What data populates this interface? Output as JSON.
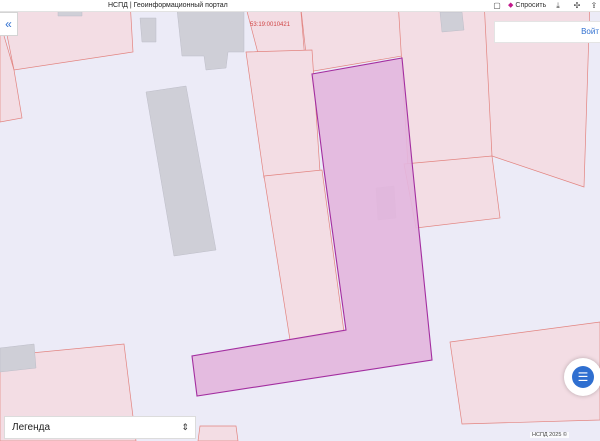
{
  "browser": {
    "tab_title": "НСПД | Геоинформационный портал",
    "ask_label": "Спросить"
  },
  "map": {
    "parcel_code": "53:19:0010421",
    "login_label": "Войт",
    "legend_label": "Легенда",
    "copyright": "НСПД 2025 ©",
    "colors": {
      "background": "#ecebf7",
      "parcel_fill": "#f3dde4",
      "parcel_border": "#e2837f",
      "building_fill": "#cfcfd7",
      "selected_fill": "#e3b6dd",
      "selected_border": "#a32ea0",
      "accent": "#2f6fd0"
    }
  },
  "icons": {
    "collapse": "double-chevron-left-icon",
    "chat": "chat-icon",
    "legend_toggle": "chevron-updown-icon",
    "bookmark": "bookmark-icon",
    "download": "download-icon",
    "extensions": "extensions-icon",
    "share": "share-icon"
  }
}
